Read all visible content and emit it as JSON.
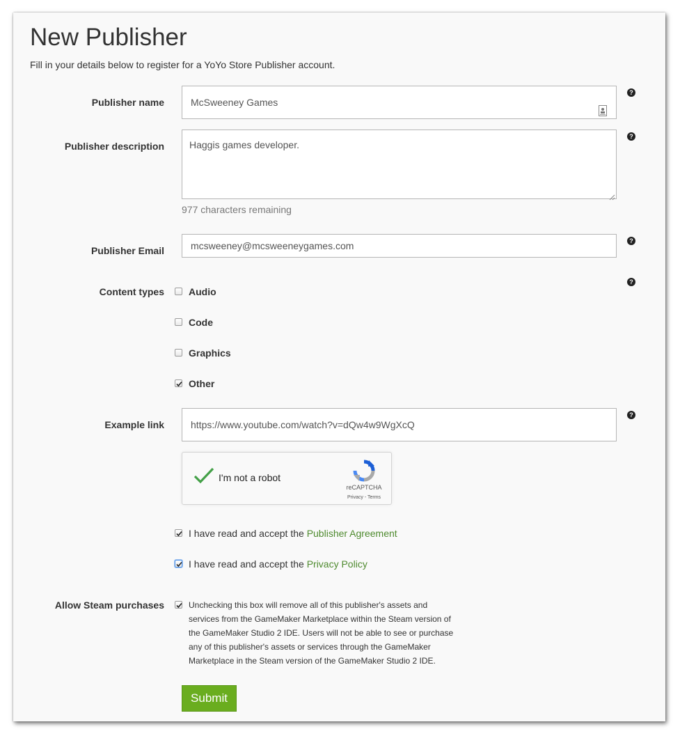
{
  "page": {
    "title": "New Publisher",
    "subtitle": "Fill in your details below to register for a YoYo Store Publisher account."
  },
  "form": {
    "name": {
      "label": "Publisher name",
      "value": "McSweeney Games",
      "icon": "contact-card-icon"
    },
    "description": {
      "label": "Publisher description",
      "value": "Haggis games developer.",
      "remaining": "977 characters remaining"
    },
    "email": {
      "label": "Publisher Email",
      "value": "mcsweeney@mcsweeneygames.com"
    },
    "content_types": {
      "label": "Content types",
      "options": [
        {
          "label": "Audio",
          "checked": false
        },
        {
          "label": "Code",
          "checked": false
        },
        {
          "label": "Graphics",
          "checked": false
        },
        {
          "label": "Other",
          "checked": true
        }
      ]
    },
    "example_link": {
      "label": "Example link",
      "value": "https://www.youtube.com/watch?v=dQw4w9WgXcQ"
    },
    "help_icon": "?",
    "recaptcha": {
      "label": "I'm not a robot",
      "brand": "reCAPTCHA",
      "privacy": "Privacy",
      "separator": " - ",
      "terms": "Terms",
      "checked": true
    },
    "agreement": {
      "prefix": "I have read and accept the ",
      "link": "Publisher Agreement",
      "checked": true
    },
    "privacy": {
      "prefix": "I have read and accept the ",
      "link": "Privacy Policy",
      "checked": true
    },
    "steam": {
      "label": "Allow Steam purchases",
      "checked": true,
      "lines": [
        "Unchecking this box will remove all of this publisher's assets and",
        "services from the GameMaker Marketplace within the Steam version of",
        "the GameMaker Studio 2 IDE. Users will not be able to see or purchase",
        "any of this publisher's assets or services through the GameMaker",
        "Marketplace in the Steam version of the GameMaker Studio 2 IDE."
      ]
    },
    "submit_label": "Submit"
  },
  "colors": {
    "link": "#4e8a2e",
    "submit": "#6aad1f",
    "check": "#43a047"
  }
}
